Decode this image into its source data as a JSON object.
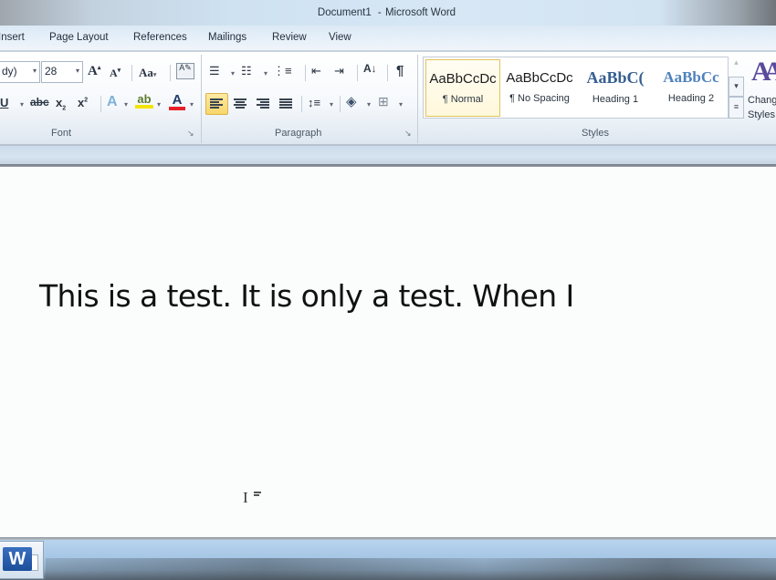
{
  "window": {
    "document_name": "Document1",
    "separator": "-",
    "app_name": "Microsoft Word"
  },
  "tabs": [
    {
      "label": "Insert"
    },
    {
      "label": "Page Layout"
    },
    {
      "label": "References"
    },
    {
      "label": "Mailings"
    },
    {
      "label": "Review"
    },
    {
      "label": "View"
    }
  ],
  "ribbon": {
    "font_group": {
      "label": "Font",
      "font_name": "dy)",
      "font_size": "28",
      "icons": [
        "grow-font-icon",
        "shrink-font-icon",
        "change-case-icon",
        "clear-formatting-icon",
        "underline-icon",
        "strikethrough-icon",
        "subscript-icon",
        "superscript-icon",
        "text-effects-icon",
        "highlight-icon",
        "font-color-icon"
      ],
      "font_color": "#e8202a",
      "highlight_color": "#f2e400"
    },
    "paragraph_group": {
      "label": "Paragraph",
      "icons": [
        "bullets-icon",
        "numbering-icon",
        "multilevel-list-icon",
        "decrease-indent-icon",
        "increase-indent-icon",
        "sort-icon",
        "show-formatting-icon",
        "align-left-icon",
        "center-icon",
        "align-right-icon",
        "justify-icon",
        "line-spacing-icon",
        "shading-icon",
        "borders-icon"
      ],
      "active_alignment": "left"
    },
    "styles_group": {
      "label": "Styles",
      "items": [
        {
          "preview": "AaBbCcDc",
          "name": "¶ Normal",
          "selected": true
        },
        {
          "preview": "AaBbCcDc",
          "name": "¶ No Spacing",
          "selected": false
        },
        {
          "preview": "AaBbC(",
          "name": "Heading 1",
          "selected": false
        },
        {
          "preview": "AaBbCc",
          "name": "Heading 2",
          "selected": false
        }
      ],
      "change_styles": {
        "glyph": "AA",
        "line1": "Chang",
        "line2": "Styles"
      }
    }
  },
  "document": {
    "text": "This is a test. It is only a test. When I"
  },
  "taskbar": {
    "app_icon_letter": "W"
  }
}
